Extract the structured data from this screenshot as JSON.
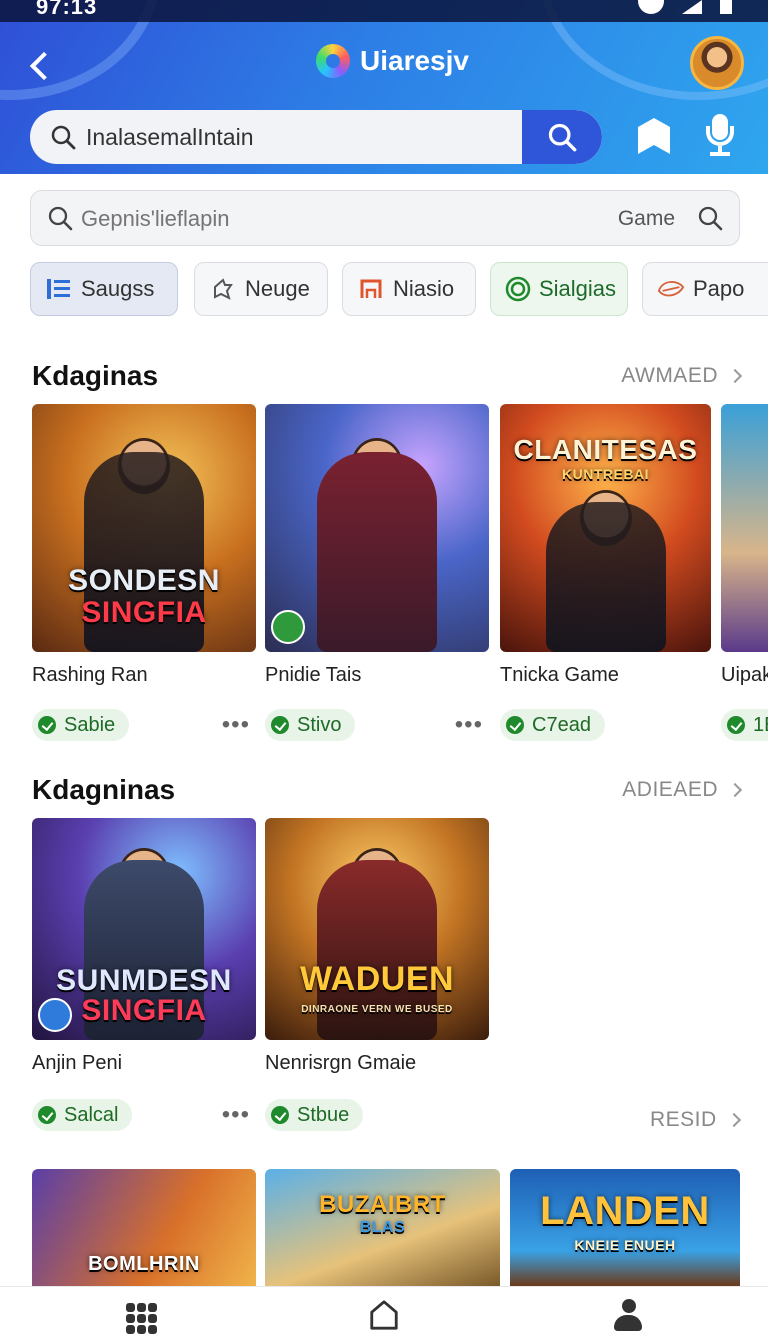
{
  "status_bar": {
    "time": "97:13"
  },
  "header": {
    "title": "Uiaresjv",
    "search_value": "InalasemalIntain"
  },
  "sub_search": {
    "placeholder": "Gepnis'lieflapin",
    "scope_label": "Game"
  },
  "chips": [
    {
      "label": "Saugss"
    },
    {
      "label": "Neuge"
    },
    {
      "label": "Niasio"
    },
    {
      "label": "Sialgias"
    },
    {
      "label": "Papo"
    }
  ],
  "section1": {
    "title": "Kdaginas",
    "more_label": "AWMAED",
    "cards": [
      {
        "title": "Rashing Ran",
        "status": "Sabie",
        "art": {
          "logo_line1": "SONDESN",
          "logo_line2": "SINGFIA"
        }
      },
      {
        "title": "Pnidie Tais",
        "status": "Stivo",
        "art": {}
      },
      {
        "title": "Tnicka Game",
        "status": "C7ead",
        "art": {
          "logo_line1": "CLANITESAS",
          "logo_line2": "KUNTREBAI"
        }
      },
      {
        "title": "Uipak",
        "status": "1E",
        "art": {}
      }
    ]
  },
  "section2": {
    "title": "Kdagninas",
    "more_label": "ADIEAED",
    "cards": [
      {
        "title": "Anjin Peni",
        "status": "Salcal",
        "art": {
          "logo_line1": "SUNMDESN",
          "logo_line2": "SINGFIA"
        }
      },
      {
        "title": "Nenrisrgn Gmaie",
        "status": "Stbue",
        "art": {
          "logo_line1": "WADUEN",
          "logo_line2": "DINRAONE VERN WE BUSED"
        }
      }
    ],
    "side_more_label": "RESID"
  },
  "section3": {
    "cards": [
      {
        "art": {
          "logo_line1": "BOMLHRIN"
        }
      },
      {
        "art": {
          "logo_line1": "BUZAIBRT",
          "logo_line2": "BLAS"
        }
      },
      {
        "art": {
          "logo_line1": "LANDEN",
          "logo_line2": "KNEIE ENUEH"
        }
      }
    ]
  },
  "colors": {
    "header_start": "#2f4fd6",
    "header_end": "#2fa6ee",
    "accent": "#2f55d8",
    "status_green": "#1f8a2b"
  },
  "icons": {
    "header": [
      "back-arrow-icon",
      "app-logo-icon",
      "avatar",
      "search-icon",
      "bookmark-icon",
      "microphone-icon"
    ],
    "bottom_nav": [
      "apps-grid-icon",
      "home-icon",
      "profile-icon"
    ]
  }
}
